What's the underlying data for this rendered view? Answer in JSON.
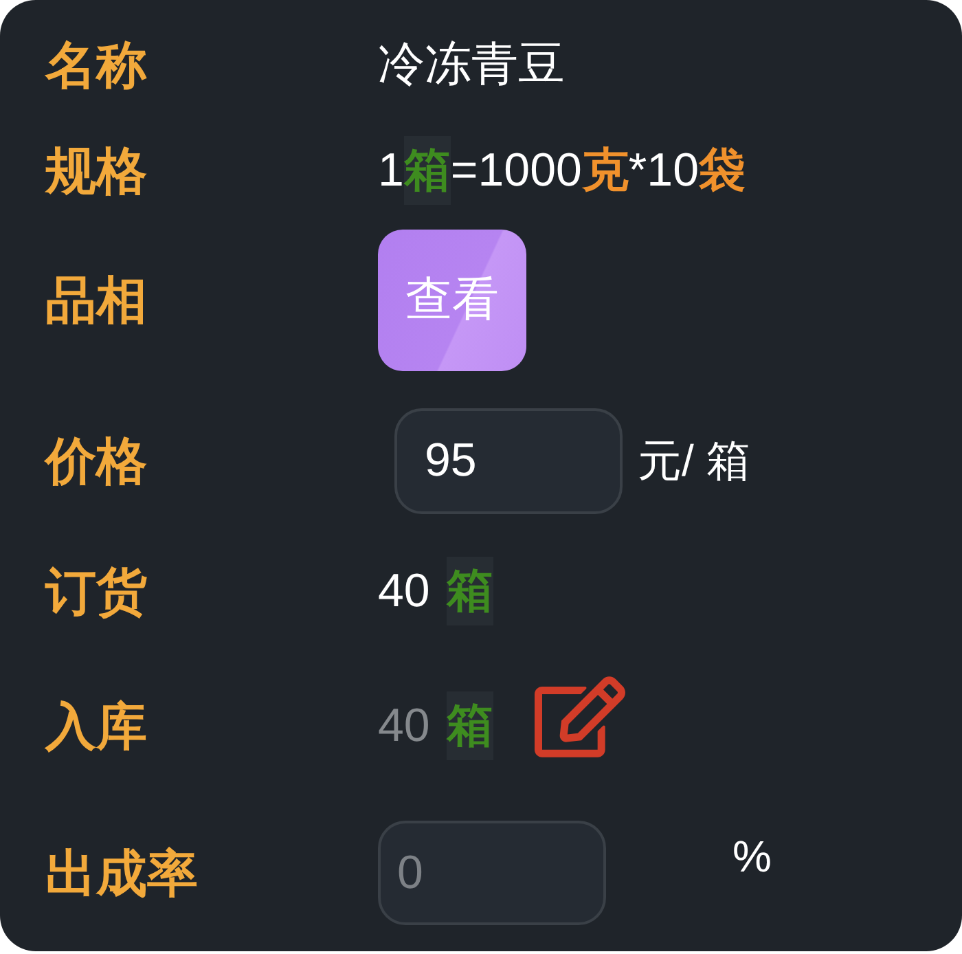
{
  "rows": [
    {
      "kind": "text",
      "label": "名称",
      "value": "冷冻青豆"
    },
    {
      "kind": "spec",
      "label": "规格",
      "segments": [
        {
          "kind": "plain",
          "text": "1"
        },
        {
          "kind": "boxed",
          "text": "箱"
        },
        {
          "kind": "plain",
          "text": "=1000"
        },
        {
          "kind": "accent",
          "text": "克"
        },
        {
          "kind": "plain",
          "text": "*10"
        },
        {
          "kind": "accent",
          "text": "袋"
        }
      ]
    },
    {
      "kind": "button",
      "label": "品相",
      "button": "查看"
    },
    {
      "kind": "price",
      "label": "价格",
      "value": "95",
      "suffix": "元/ 箱"
    },
    {
      "kind": "quantity",
      "label": "订货",
      "quantity": "40",
      "unit": "箱",
      "disabled": false,
      "editable": false
    },
    {
      "kind": "quantity",
      "label": "入库",
      "quantity": "40",
      "unit": "箱",
      "disabled": true,
      "editable": true
    },
    {
      "kind": "rate",
      "label": "出成率",
      "placeholder": "0",
      "suffix": "%"
    }
  ]
}
